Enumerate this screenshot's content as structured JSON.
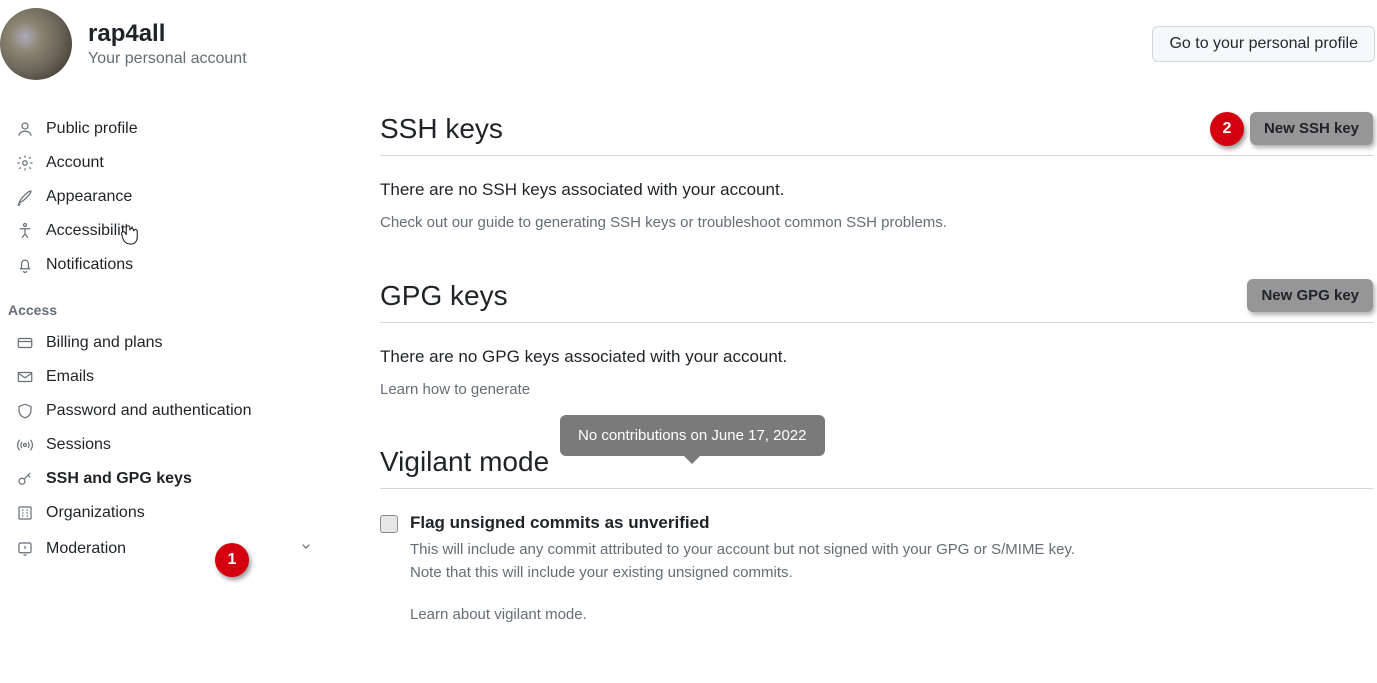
{
  "user": {
    "name": "rap4all",
    "subtitle": "Your personal account"
  },
  "profile_button": "Go to your personal profile",
  "sidebar": {
    "top": [
      {
        "label": "Public profile"
      },
      {
        "label": "Account"
      },
      {
        "label": "Appearance"
      },
      {
        "label": "Accessibility"
      },
      {
        "label": "Notifications"
      }
    ],
    "access_header": "Access",
    "access": [
      {
        "label": "Billing and plans"
      },
      {
        "label": "Emails"
      },
      {
        "label": "Password and authentication"
      },
      {
        "label": "Sessions"
      },
      {
        "label": "SSH and GPG keys"
      },
      {
        "label": "Organizations"
      },
      {
        "label": "Moderation"
      }
    ]
  },
  "ssh": {
    "title": "SSH keys",
    "button": "New SSH key",
    "empty": "There are no SSH keys associated with your account.",
    "help": "Check out our guide to generating SSH keys or troubleshoot common SSH problems."
  },
  "gpg": {
    "title": "GPG keys",
    "button": "New GPG key",
    "empty": "There are no GPG keys associated with your account.",
    "help_prefix": "Learn how to generate "
  },
  "tooltip": "No contributions on June 17, 2022",
  "vigilant": {
    "title": "Vigilant mode",
    "flag_label": "Flag unsigned commits as unverified",
    "desc1": "This will include any commit attributed to your account but not signed with your GPG or S/MIME key.",
    "desc2": "Note that this will include your existing unsigned commits.",
    "learn": "Learn about vigilant mode."
  },
  "callouts": {
    "one": "1",
    "two": "2"
  }
}
